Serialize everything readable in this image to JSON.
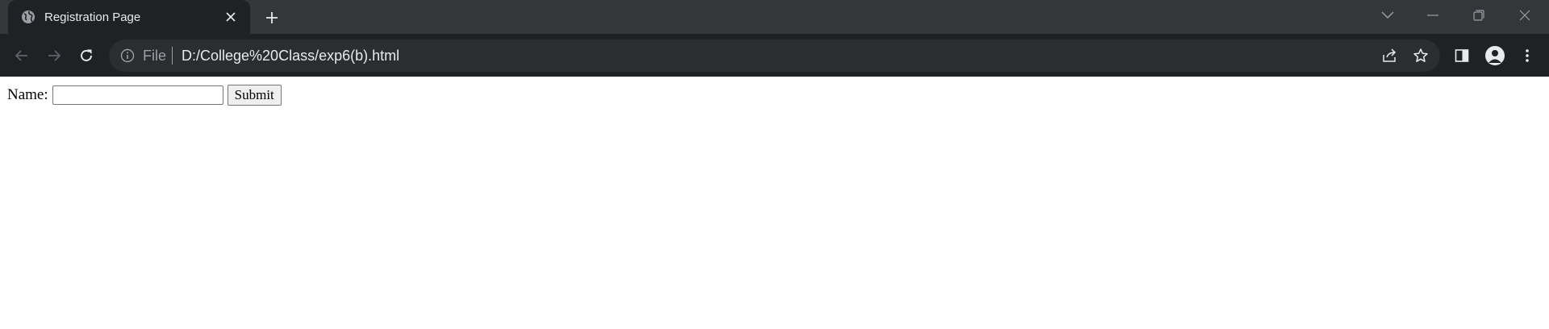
{
  "tab": {
    "title": "Registration Page"
  },
  "omnibox": {
    "scheme_label": "File",
    "url": "D:/College%20Class/exp6(b).html"
  },
  "form": {
    "name_label": "Name:",
    "name_value": "",
    "submit_label": "Submit"
  },
  "colors": {
    "titlebar": "#35363a",
    "toolbar": "#202124",
    "omnibox": "#2c2d30",
    "icon": "#9aa0a6",
    "text": "#e8eaed"
  },
  "icons": [
    "globe-icon",
    "close-icon",
    "plus-icon",
    "chevron-down-icon",
    "minimize-icon",
    "restore-icon",
    "close-window-icon",
    "back-arrow-icon",
    "forward-arrow-icon",
    "reload-icon",
    "info-icon",
    "share-icon",
    "star-icon",
    "side-panel-icon",
    "profile-icon",
    "kebab-menu-icon"
  ]
}
